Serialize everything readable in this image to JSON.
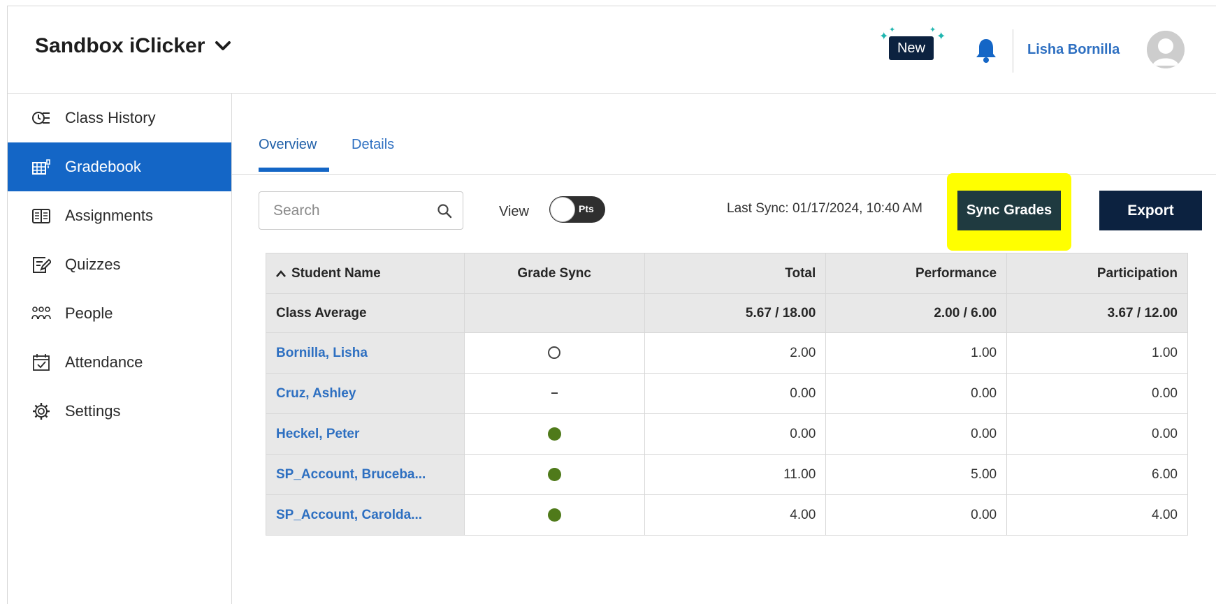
{
  "header": {
    "course_title": "Sandbox iClicker",
    "new_badge": "New",
    "user_name": "Lisha Bornilla"
  },
  "sidebar": {
    "items": [
      {
        "label": "Class History",
        "icon": "clock-list-icon"
      },
      {
        "label": "Gradebook",
        "icon": "gradebook-icon",
        "active": true
      },
      {
        "label": "Assignments",
        "icon": "book-icon"
      },
      {
        "label": "Quizzes",
        "icon": "quiz-edit-icon"
      },
      {
        "label": "People",
        "icon": "people-icon"
      },
      {
        "label": "Attendance",
        "icon": "calendar-check-icon"
      },
      {
        "label": "Settings",
        "icon": "gear-icon"
      }
    ]
  },
  "tabs": {
    "overview": "Overview",
    "details": "Details"
  },
  "toolbar": {
    "search_placeholder": "Search",
    "view_label": "View",
    "toggle_label": "Pts",
    "last_sync": "Last Sync: 01/17/2024, 10:40 AM",
    "sync_button": "Sync Grades",
    "export_button": "Export"
  },
  "table": {
    "headers": {
      "student_name": "Student Name",
      "grade_sync": "Grade Sync",
      "total": "Total",
      "performance": "Performance",
      "participation": "Participation"
    },
    "class_average": {
      "label": "Class Average",
      "total": "5.67 / 18.00",
      "performance": "2.00 / 6.00",
      "participation": "3.67 / 12.00"
    },
    "rows": [
      {
        "name": "Bornilla, Lisha",
        "sync": "empty",
        "total": "2.00",
        "performance": "1.00",
        "participation": "1.00"
      },
      {
        "name": "Cruz, Ashley",
        "sync": "dash",
        "total": "0.00",
        "performance": "0.00",
        "participation": "0.00"
      },
      {
        "name": "Heckel, Peter",
        "sync": "synced",
        "total": "0.00",
        "performance": "0.00",
        "participation": "0.00"
      },
      {
        "name": "SP_Account, Bruceba...",
        "sync": "synced",
        "total": "11.00",
        "performance": "5.00",
        "participation": "6.00"
      },
      {
        "name": "SP_Account, Carolda...",
        "sync": "synced",
        "total": "4.00",
        "performance": "0.00",
        "participation": "4.00"
      }
    ]
  },
  "colors": {
    "primary_blue": "#1466c6",
    "navy": "#0c2240",
    "sync_button_bg": "#1f3a40",
    "highlight_yellow": "#ffff00",
    "synced_green": "#4f7a1a"
  }
}
